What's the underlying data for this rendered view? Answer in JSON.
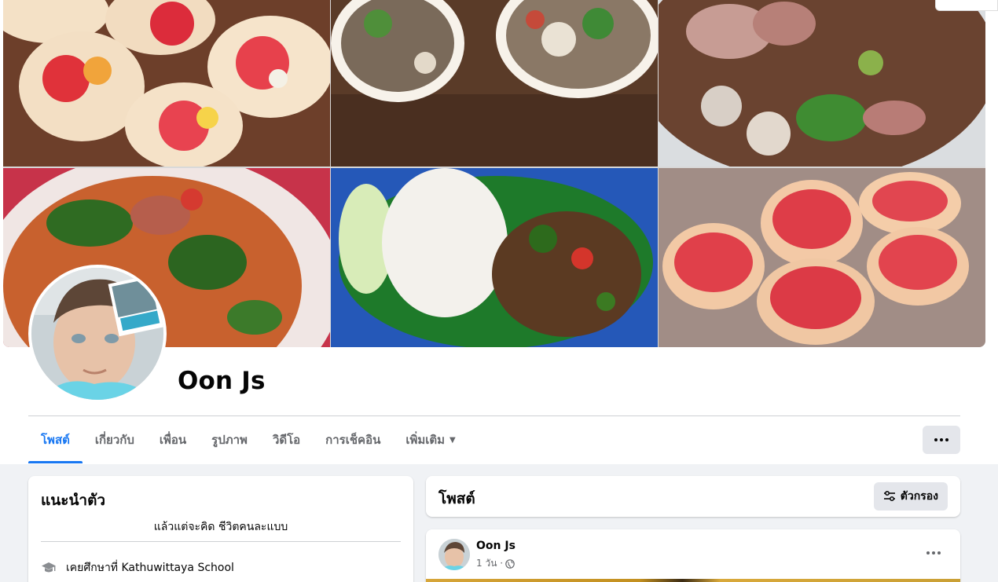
{
  "profile": {
    "name": "Oon Js"
  },
  "tabs": [
    {
      "label": "โพสต์",
      "active": true
    },
    {
      "label": "เกี่ยวกับ",
      "active": false
    },
    {
      "label": "เพื่อน",
      "active": false
    },
    {
      "label": "รูปภาพ",
      "active": false
    },
    {
      "label": "วิดีโอ",
      "active": false
    },
    {
      "label": "การเช็คอิน",
      "active": false
    },
    {
      "label": "เพิ่มเติม",
      "active": false
    }
  ],
  "intro": {
    "title": "แนะนำตัว",
    "bio": "แล้วแต่จะคิด ชีวิตคนละแบบ",
    "education": "เคยศึกษาที่ Kathuwittaya School"
  },
  "posts_section": {
    "title": "โพสต์",
    "filter_label": "ตัวกรอง"
  },
  "post": {
    "author": "Oon Js",
    "time": "1 วัน ·"
  },
  "colors": {
    "accent": "#1877f2",
    "page_background": "#f0f2f5",
    "secondary_button": "#e4e6eb"
  },
  "icons": {
    "more": "more-dots-icon",
    "filter": "filter-sliders-icon",
    "education": "graduation-cap-icon",
    "privacy": "globe-icon",
    "dropdown": "caret-down-icon"
  }
}
